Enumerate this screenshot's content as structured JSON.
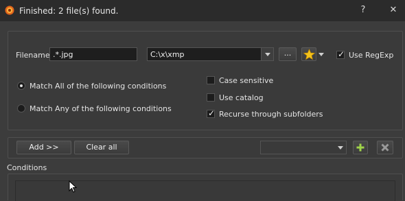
{
  "window": {
    "title": "Finished: 2 file(s) found.",
    "help_label": "?",
    "close_label": "✕"
  },
  "search": {
    "filename_label": "Filename",
    "filename_value": ".*.jpg",
    "path_value": "C:\\x\\xmp",
    "browse_label": "...",
    "use_regexp_label": "Use RegExp",
    "use_regexp_checked": true
  },
  "match": {
    "all_label": "Match All of the following conditions",
    "any_label": "Match Any of the following conditions",
    "selected": "all"
  },
  "options": {
    "case_sensitive_label": "Case sensitive",
    "case_sensitive_checked": false,
    "use_catalog_label": "Use catalog",
    "use_catalog_checked": false,
    "recurse_label": "Recurse through subfolders",
    "recurse_checked": true
  },
  "toolbar": {
    "add_label": "Add >>",
    "clear_label": "Clear all",
    "preset_value": "",
    "add_icon": "plus-icon",
    "remove_icon": "x-icon",
    "add_icon_color": "#9fd34a"
  },
  "conditions": {
    "section_label": "Conditions"
  },
  "colors": {
    "background": "#3c3c3c",
    "titlebar": "#2b2b2b",
    "star": "#f3c21b"
  }
}
